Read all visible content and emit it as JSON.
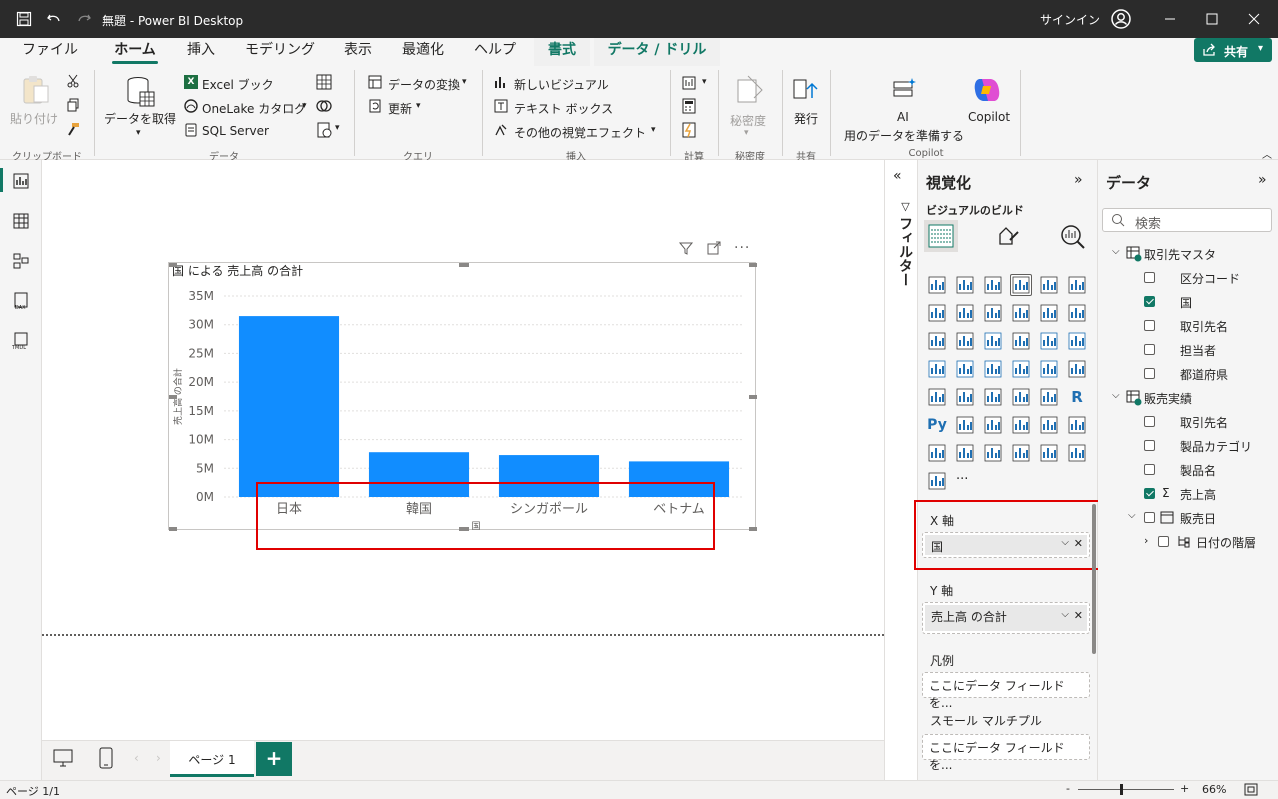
{
  "titlebar": {
    "title": "無題 - Power BI Desktop",
    "signin": "サインイン"
  },
  "menu": {
    "tabs": [
      "ファイル",
      "ホーム",
      "挿入",
      "モデリング",
      "表示",
      "最適化",
      "ヘルプ",
      "書式",
      "データ / ドリル"
    ],
    "share": "共有"
  },
  "ribbon": {
    "paste": "貼り付け",
    "get_data": "データを取得",
    "excel": "Excel ブック",
    "onelake": "OneLake カタログ",
    "sql": "SQL Server",
    "transform": "データの変換",
    "refresh": "更新",
    "new_visual": "新しいビジュアル",
    "text_box": "テキスト ボックス",
    "more_visuals": "その他の視覚エフェクト",
    "sensitivity": "秘密度",
    "publish": "発行",
    "ai_line1": "AI",
    "ai_line2": "用のデータを準備する",
    "copilot": "Copilot",
    "groups": {
      "clipboard": "クリップボード",
      "data": "データ",
      "query": "クエリ",
      "insert": "挿入",
      "calc": "計算",
      "sensitivity": "秘密度",
      "share": "共有",
      "copilot": "Copilot"
    }
  },
  "chart_data": {
    "type": "bar",
    "title": "国 による 売上高 の合計",
    "categories": [
      "日本",
      "韓国",
      "シンガポール",
      "ベトナム"
    ],
    "values": [
      31500000,
      7800000,
      7300000,
      6200000
    ],
    "ylim": [
      0,
      35000000
    ],
    "yticks": [
      "35M",
      "30M",
      "25M",
      "20M",
      "15M",
      "10M",
      "5M",
      "0M"
    ],
    "xlabel": "国",
    "ylabel": "売上高 の合計",
    "bar_color": "#118dff",
    "grid": true
  },
  "pages": {
    "page1": "ページ 1",
    "add": "+"
  },
  "status": {
    "page": "ページ 1/1",
    "zoom": "66%",
    "minus": "-",
    "plus": "+"
  },
  "filters": {
    "label": "フィルター"
  },
  "viz": {
    "title": "視覚化",
    "build": "ビジュアルのビルド",
    "more": "···",
    "xaxis": "X 軸",
    "xaxis_field": "国",
    "yaxis": "Y 軸",
    "yaxis_field": "売上高 の合計",
    "legend": "凡例",
    "legend_ph": "ここにデータ フィールドを...",
    "small": "スモール マルチプル",
    "small_ph": "ここにデータ フィールドを..."
  },
  "data": {
    "title": "データ",
    "search_ph": "検索",
    "table1": "取引先マスタ",
    "t1_fields": [
      "区分コード",
      "国",
      "取引先名",
      "担当者",
      "都道府県"
    ],
    "table2": "販売実績",
    "t2_fields": [
      "取引先名",
      "製品カテゴリ",
      "製品名",
      "売上高"
    ],
    "date_field": "販売日",
    "hierarchy": "日付の階層"
  }
}
